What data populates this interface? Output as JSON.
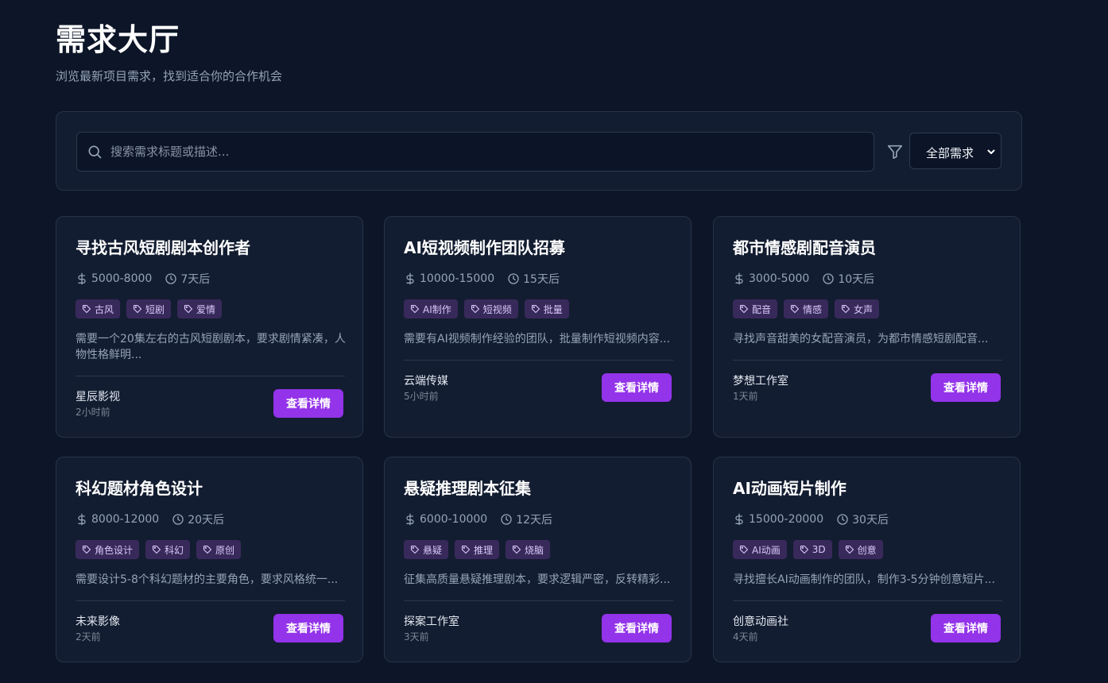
{
  "header": {
    "title": "需求大厅",
    "subtitle": "浏览最新项目需求，找到适合你的合作机会"
  },
  "search": {
    "placeholder": "搜索需求标题或描述...",
    "value": "",
    "search_icon": "search-icon",
    "filter_icon": "filter-icon",
    "category_selected": "全部需求"
  },
  "colors": {
    "background": "#0d1628",
    "card": "#131d31",
    "accent": "#9333ea",
    "tag_bg": "#38295b"
  },
  "detail_button_label": "查看详情",
  "cards": [
    {
      "title": "寻找古风短剧剧本创作者",
      "budget": "5000-8000",
      "deadline": "7天后",
      "tags": [
        "古风",
        "短剧",
        "爱情"
      ],
      "description": "需要一个20集左右的古风短剧剧本，要求剧情紧凑，人物性格鲜明...",
      "company": "星辰影视",
      "posted": "2小时前"
    },
    {
      "title": "AI短视频制作团队招募",
      "budget": "10000-15000",
      "deadline": "15天后",
      "tags": [
        "AI制作",
        "短视频",
        "批量"
      ],
      "description": "需要有AI视频制作经验的团队，批量制作短视频内容...",
      "company": "云端传媒",
      "posted": "5小时前"
    },
    {
      "title": "都市情感剧配音演员",
      "budget": "3000-5000",
      "deadline": "10天后",
      "tags": [
        "配音",
        "情感",
        "女声"
      ],
      "description": "寻找声音甜美的女配音演员，为都市情感短剧配音...",
      "company": "梦想工作室",
      "posted": "1天前"
    },
    {
      "title": "科幻题材角色设计",
      "budget": "8000-12000",
      "deadline": "20天后",
      "tags": [
        "角色设计",
        "科幻",
        "原创"
      ],
      "description": "需要设计5-8个科幻题材的主要角色，要求风格统一...",
      "company": "未来影像",
      "posted": "2天前"
    },
    {
      "title": "悬疑推理剧本征集",
      "budget": "6000-10000",
      "deadline": "12天后",
      "tags": [
        "悬疑",
        "推理",
        "烧脑"
      ],
      "description": "征集高质量悬疑推理剧本，要求逻辑严密，反转精彩...",
      "company": "探案工作室",
      "posted": "3天前"
    },
    {
      "title": "AI动画短片制作",
      "budget": "15000-20000",
      "deadline": "30天后",
      "tags": [
        "AI动画",
        "3D",
        "创意"
      ],
      "description": "寻找擅长AI动画制作的团队，制作3-5分钟创意短片...",
      "company": "创意动画社",
      "posted": "4天前"
    }
  ]
}
